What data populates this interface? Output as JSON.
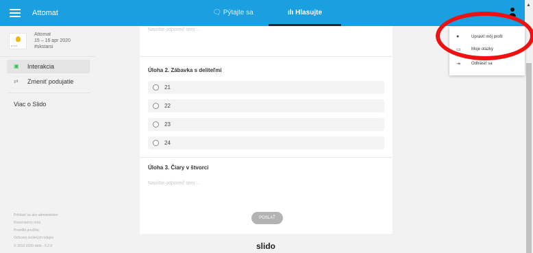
{
  "header": {
    "event_name": "Attomat",
    "tab_questions": "Pýtajte sa",
    "tab_polls": "Hlasujte",
    "accent_color": "#1a9fe0"
  },
  "sidebar": {
    "event": {
      "name": "Attomat",
      "dates": "15 – 16 apr 2020",
      "code": "#skstarsi",
      "logo_text": "p.nut"
    },
    "nav": [
      {
        "label": "Interakcia",
        "icon": "chat-icon",
        "active": true
      },
      {
        "label": "Zmeniť podujatie",
        "icon": "switch-icon",
        "active": false
      }
    ],
    "more_label": "Viac o Slido",
    "footer_links": [
      "Prihlásiť sa ako administrátor",
      "Prezentačný mód",
      "Pravidlá použitia",
      "Ochrana osobných údajov",
      "© 2012-2020 slido - 6.2.0"
    ]
  },
  "poll": {
    "answer_placeholder_top": "Napíšte odpoveď sem ...",
    "q2": {
      "title": "Úloha 2. Zábavka s deliteľmi",
      "options": [
        "21",
        "22",
        "23",
        "24"
      ]
    },
    "q3": {
      "title": "Úloha 3. Čiary v štvorci",
      "placeholder": "Napíšte odpoveď sem ..."
    },
    "send_label": "POSLAŤ"
  },
  "brand": "slido",
  "user_menu": {
    "items": [
      {
        "label": "Upraviť môj profil",
        "icon": "person-icon"
      },
      {
        "label": "Moje otázky",
        "icon": "question-icon"
      },
      {
        "label": "Odhlásiť sa",
        "icon": "logout-icon"
      }
    ]
  },
  "annotation_color": "#ee1111"
}
